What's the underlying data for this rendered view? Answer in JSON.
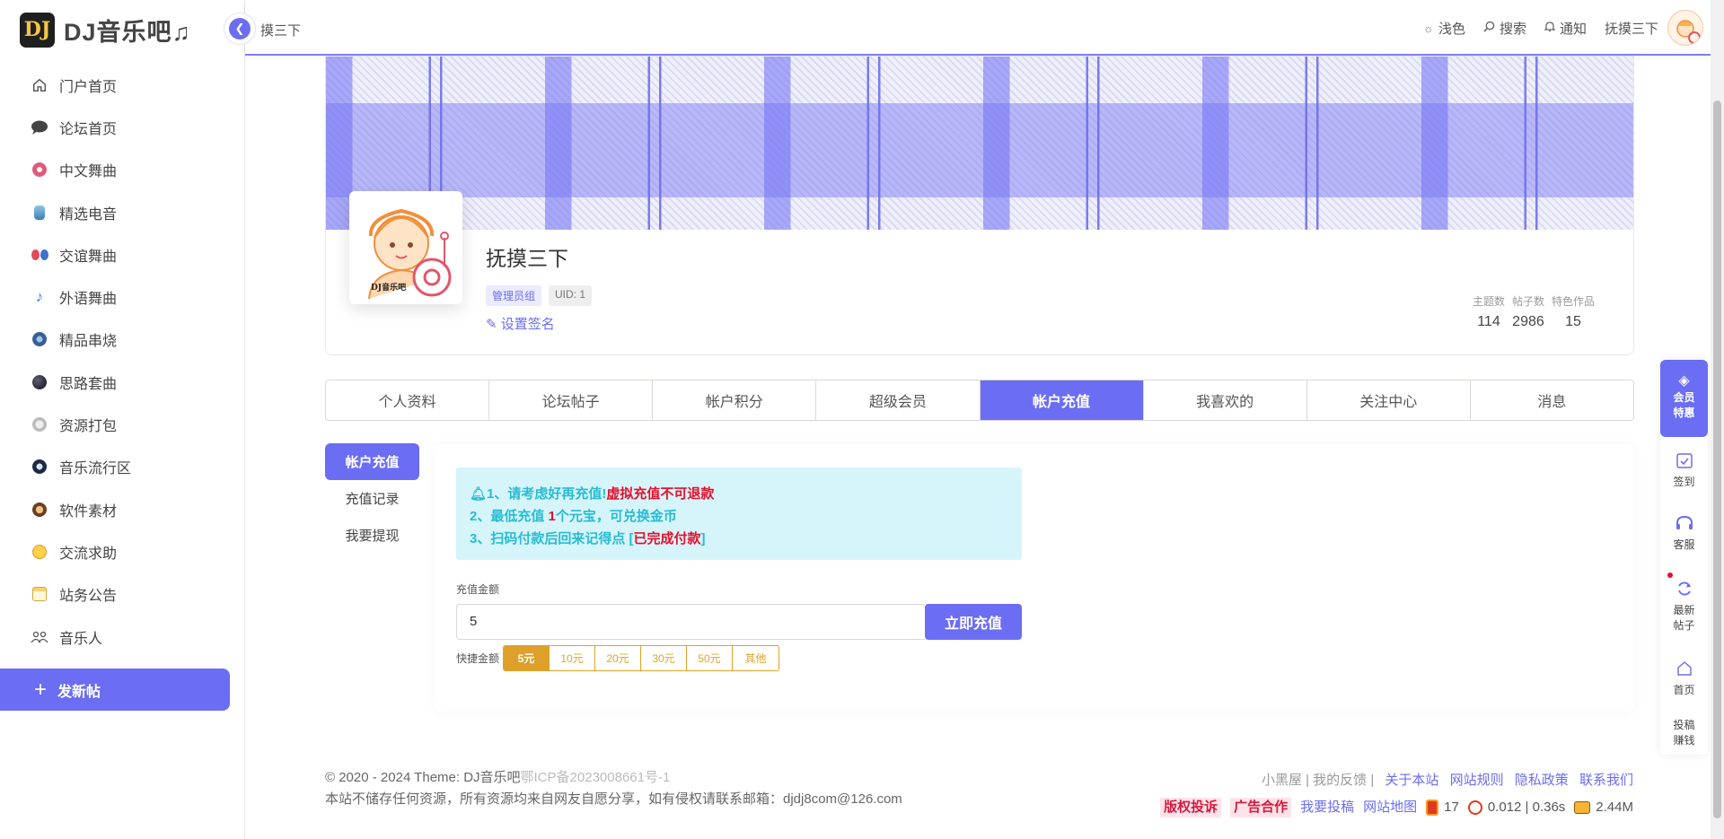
{
  "logo": {
    "mark": "DJ",
    "text": "DJ音乐吧♫"
  },
  "topbar": {
    "breadcrumb": "摸三下",
    "theme": "浅色",
    "search": "搜索",
    "notify": "通知",
    "username": "抚摸三下"
  },
  "sidebar": {
    "items": [
      {
        "label": "门户首页",
        "icon": "home-icon"
      },
      {
        "label": "论坛首页",
        "icon": "chat-bubble-icon"
      },
      {
        "label": "中文舞曲",
        "icon": "disc-icon"
      },
      {
        "label": "精选电音",
        "icon": "bottle-icon"
      },
      {
        "label": "交谊舞曲",
        "icon": "dancers-icon"
      },
      {
        "label": "外语舞曲",
        "icon": "note-icon"
      },
      {
        "label": "精品串烧",
        "icon": "record-icon"
      },
      {
        "label": "思路套曲",
        "icon": "moon-icon"
      },
      {
        "label": "资源打包",
        "icon": "package-icon"
      },
      {
        "label": "音乐流行区",
        "icon": "planet-icon"
      },
      {
        "label": "软件素材",
        "icon": "monkey-icon"
      },
      {
        "label": "交流求助",
        "icon": "help-icon"
      },
      {
        "label": "站务公告",
        "icon": "notepad-icon"
      },
      {
        "label": "音乐人",
        "icon": "people-icon"
      }
    ],
    "post_button": "发新帖"
  },
  "profile": {
    "name": "抚摸三下",
    "badge_group": "管理员组",
    "badge_uid": "UID: 1",
    "sign": "设置签名",
    "avatar_caption": "DJ音乐吧",
    "stats": [
      {
        "label": "主题数",
        "value": "114"
      },
      {
        "label": "帖子数",
        "value": "2986"
      },
      {
        "label": "特色作品",
        "value": "15"
      }
    ]
  },
  "tabs": [
    "个人资料",
    "论坛帖子",
    "帐户积分",
    "超级会员",
    "帐户充值",
    "我喜欢的",
    "关注中心",
    "消息"
  ],
  "side_menu": [
    "帐户充值",
    "充值记录",
    "我要提现"
  ],
  "recharge": {
    "notice_1a": "1、请考虑好再充值!",
    "notice_1b": "虚拟充值不可退款",
    "notice_2a": "2、最低充值 ",
    "notice_2b": "1",
    "notice_2c": "个元宝，可兑换金币",
    "notice_3a": "3、扫码付款后回来记得点 [",
    "notice_3b": "已完成付款",
    "notice_3c": "]",
    "amount_label": "充值金额",
    "amount_value": "5",
    "pay_button": "立即充值",
    "quick_label": "快捷金额",
    "quick_options": [
      "5元",
      "10元",
      "20元",
      "30元",
      "50元",
      "其他"
    ]
  },
  "footer": {
    "copyright": "© 2020 - 2024 Theme: DJ音乐吧",
    "icp": "鄂ICP备2023008661号-1",
    "disclaimer": "本站不储存任何资源，所有资源均来自网友自愿分享，如有侵权请联系邮箱：djdj8com@126.com",
    "links_gray": "小黑屋 | 我的反馈 |",
    "links": [
      "关于本站",
      "网站规则",
      "隐私政策",
      "联系我们"
    ],
    "tag_1": "版权投诉",
    "tag_2": "广告合作",
    "link_submit": "我要投稿",
    "link_sitemap": "网站地图",
    "count": "17",
    "timing": "0.012 | 0.36s",
    "memory": "2.44M"
  },
  "float_bar": {
    "vip_1": "会员",
    "vip_2": "特惠",
    "checkin": "签到",
    "service": "客服",
    "latest_1": "最新",
    "latest_2": "帖子",
    "home": "首页",
    "earn_1": "投稿",
    "earn_2": "赚钱"
  },
  "colors": {
    "accent": "#6b6df2",
    "notice_text": "#27bcd3",
    "danger": "#e5102c",
    "quick": "#dea02a"
  }
}
